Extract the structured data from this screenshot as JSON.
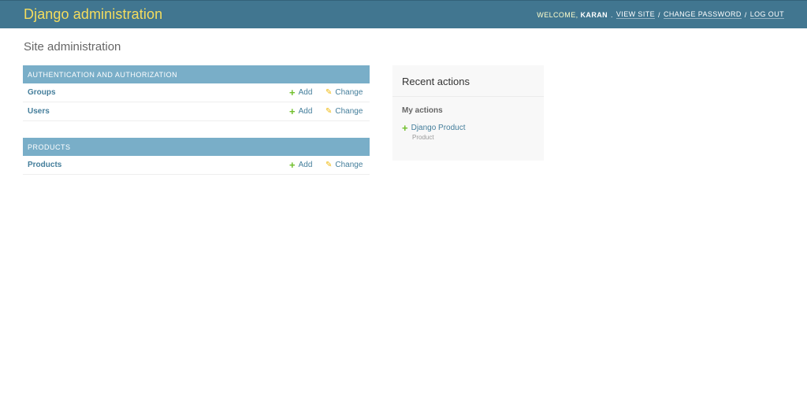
{
  "header": {
    "branding": "Django administration",
    "welcome_label": "WELCOME,",
    "username": "KARAN",
    "links": [
      "VIEW SITE",
      "CHANGE PASSWORD",
      "LOG OUT"
    ],
    "separator": "/"
  },
  "page_title": "Site administration",
  "modules": [
    {
      "caption": "AUTHENTICATION AND AUTHORIZATION",
      "rows": [
        {
          "model": "Groups",
          "add": "Add",
          "change": "Change"
        },
        {
          "model": "Users",
          "add": "Add",
          "change": "Change"
        }
      ]
    },
    {
      "caption": "PRODUCTS",
      "rows": [
        {
          "model": "Products",
          "add": "Add",
          "change": "Change"
        }
      ]
    }
  ],
  "recent_actions": {
    "title": "Recent actions",
    "subtitle": "My actions",
    "entries": [
      {
        "name": "Django Product",
        "type": "Product",
        "action_icon": "plus-icon"
      }
    ]
  },
  "colors": {
    "header_bg": "#417690",
    "branding": "#f5dd5d",
    "caption_bg": "#79aec8",
    "link": "#447e9b",
    "add_icon": "#70bf2b",
    "change_icon": "#efb80b"
  }
}
